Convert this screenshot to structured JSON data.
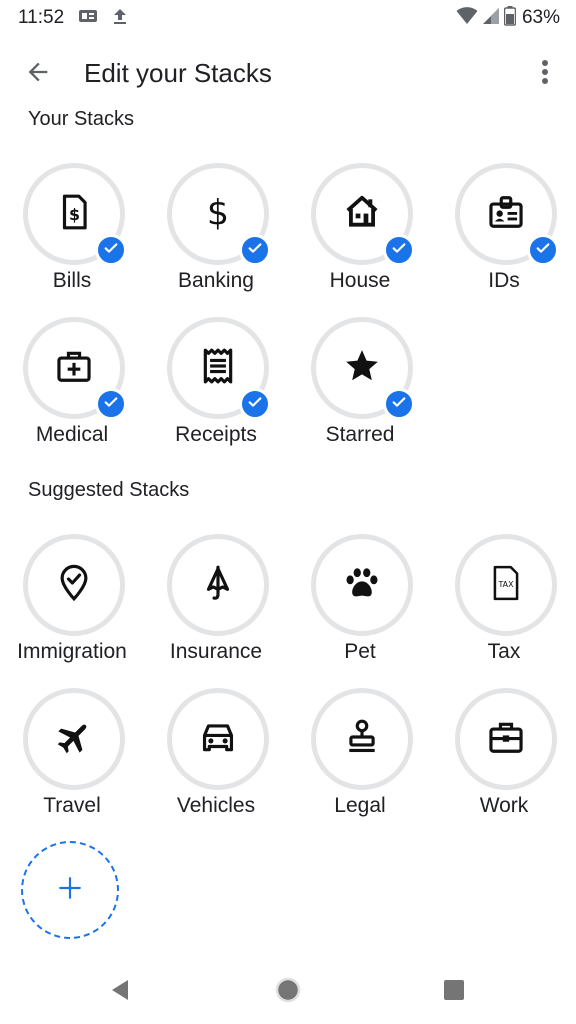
{
  "status_bar": {
    "time": "11:52",
    "battery": "63%"
  },
  "app_bar": {
    "title": "Edit your Stacks"
  },
  "your_stacks": {
    "heading": "Your Stacks",
    "items": [
      {
        "label": "Bills",
        "icon": "bill-icon",
        "selected": true
      },
      {
        "label": "Banking",
        "icon": "dollar-icon",
        "selected": true
      },
      {
        "label": "House",
        "icon": "house-icon",
        "selected": true
      },
      {
        "label": "IDs",
        "icon": "id-badge-icon",
        "selected": true
      },
      {
        "label": "Medical",
        "icon": "medical-kit-icon",
        "selected": true
      },
      {
        "label": "Receipts",
        "icon": "receipt-icon",
        "selected": true
      },
      {
        "label": "Starred",
        "icon": "star-icon",
        "selected": true
      }
    ]
  },
  "suggested_stacks": {
    "heading": "Suggested Stacks",
    "items": [
      {
        "label": "Immigration",
        "icon": "location-check-icon"
      },
      {
        "label": "Insurance",
        "icon": "umbrella-icon"
      },
      {
        "label": "Pet",
        "icon": "paw-icon"
      },
      {
        "label": "Tax",
        "icon": "tax-document-icon",
        "icon_text": "TAX"
      },
      {
        "label": "Travel",
        "icon": "airplane-icon"
      },
      {
        "label": "Vehicles",
        "icon": "car-icon"
      },
      {
        "label": "Legal",
        "icon": "stamp-icon"
      },
      {
        "label": "Work",
        "icon": "briefcase-icon"
      }
    ]
  },
  "colors": {
    "accent": "#1a73e8",
    "circle_border": "#e3e4e6",
    "text": "#202124"
  }
}
